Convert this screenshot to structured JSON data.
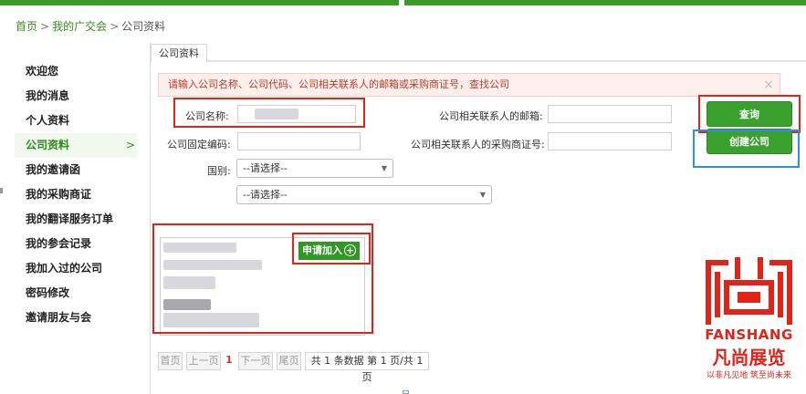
{
  "breadcrumb": {
    "home": "首页",
    "my_fair": "我的广交会",
    "current": "公司资料",
    "separator": ">"
  },
  "sidebar": {
    "items": [
      {
        "label": "欢迎您"
      },
      {
        "label": "我的消息"
      },
      {
        "label": "个人资料"
      },
      {
        "label": "公司资料",
        "active": true
      },
      {
        "label": "我的邀请函"
      },
      {
        "label": "我的采购商证"
      },
      {
        "label": "我的翻译服务订单"
      },
      {
        "label": "我的参会记录"
      },
      {
        "label": "我加入过的公司"
      },
      {
        "label": "密码修改"
      },
      {
        "label": "邀请朋友与会"
      }
    ],
    "active_chevron": ">"
  },
  "tab": {
    "label": "公司资料"
  },
  "notice": {
    "text": "请输入公司名称、公司代码、公司相关联系人的邮箱或采购商证号，查找公司",
    "close": "×"
  },
  "form": {
    "company_name_label": "公司名称:",
    "email_label": "公司相关联系人的邮箱:",
    "fixed_code_label": "公司固定编码:",
    "cert_label": "公司相关联系人的采购商证号:",
    "country_label": "国别:",
    "country_select": "--请选择--",
    "region_select": "--请选择--"
  },
  "buttons": {
    "query": "查询",
    "create": "创建公司",
    "apply": "申请加入"
  },
  "pager": {
    "first": "首页",
    "prev": "上一页",
    "current_page": "1",
    "next": "下一页",
    "last": "尾页",
    "info": "共 1 条数据 第 1 页/共 1 页"
  },
  "watermark": {
    "brand_en": "FANSHANG",
    "brand_cn": "凡尚展览",
    "slogan": "以非凡见地 筑至尚未来"
  },
  "colors": {
    "primary_green": "#3ba12e",
    "highlight_red": "#e2231a",
    "highlight_blue": "#2f8fe0",
    "notice_bg": "#fdf0ec"
  }
}
